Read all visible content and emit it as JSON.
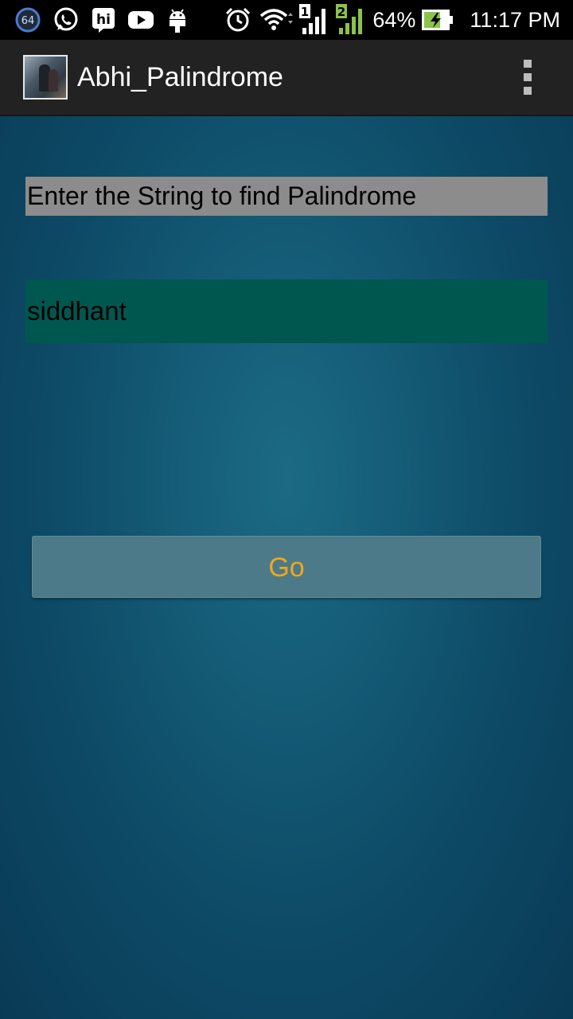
{
  "status_bar": {
    "notification_badge": "64",
    "battery_percent": "64%",
    "time": "11:17 PM",
    "sim1_label": "1",
    "sim2_label": "2",
    "hike_label": "hi"
  },
  "action_bar": {
    "title": "Abhi_Palindrome"
  },
  "main": {
    "prompt_label": "Enter the String to find Palindrome",
    "input_value": "siddhant",
    "go_button_label": "Go"
  },
  "colors": {
    "action_bar": "#222222",
    "prompt_bg": "#8c8c8c",
    "input_bg": "#00574f",
    "button_bg": "#4d7a88",
    "button_text": "#f0a81a",
    "battery_accent": "#8bc34a"
  }
}
